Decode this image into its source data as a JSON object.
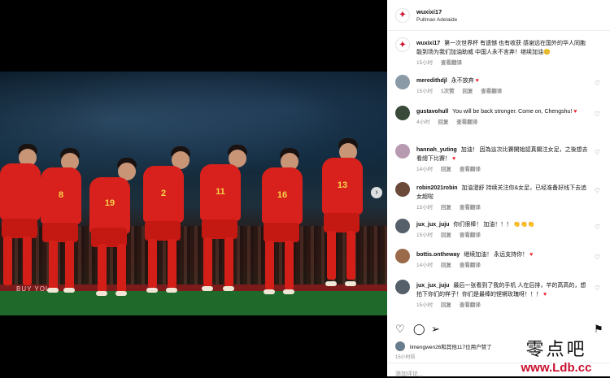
{
  "post": {
    "username": "wuxixi17",
    "location": "Pullman Adelaide",
    "caption": "第一次世界杯 有遗憾 也有收获 感谢远在国外的华人同胞能到场为我们加油助威 中国人永不言弃！继续加油😊",
    "caption_time": "15小时",
    "caption_translate": "查看翻译",
    "photo_ad_text": "BUY YOUR"
  },
  "comments": [
    {
      "username": "meredithdjl",
      "text": "永不放弃",
      "time": "15小时",
      "likes": "1次赞",
      "reply": "回复",
      "translate": "查看翻译",
      "heart": true
    },
    {
      "username": "gustavohull",
      "text": "You will be back stronger. Come on, Chengshu!",
      "time": "4小时",
      "reply": "回复",
      "translate": "查看翻译",
      "heart": true
    },
    {
      "username": "hannah_yuting",
      "text": "加油！ 因為這次比賽開始認真關注女足，之後想去看總下比賽！",
      "time": "14小时",
      "reply": "回复",
      "translate": "查看翻译"
    },
    {
      "username": "robin2021robin",
      "text": "加油澄舒 持续关注你&女足，已经准备好线下去追女超啦",
      "time": "15小时",
      "reply": "回复",
      "translate": "查看翻译"
    },
    {
      "username": "jux_jux_juju",
      "text": "你们很棒！ 加油！！！",
      "time": "15小时",
      "reply": "回复",
      "translate": "查看翻译"
    },
    {
      "username": "bottis.ontheway",
      "text": "继续加油！ 永远支持你！",
      "time": "14小时",
      "reply": "回复",
      "translate": "查看翻译"
    },
    {
      "username": "jux_jux_juju",
      "text": "最后一张看到了我的手机 人在后排，芊的高高的，想拍下你们的样子！你们是最棒的铿锵玫瑰呀！！！",
      "time": "15小时",
      "reply": "回复",
      "translate": "查看翻译"
    }
  ],
  "likes_text": "limengwen26和其他117位用户赞了",
  "time_ago": "15小时前",
  "add_comment_placeholder": "添加评论...",
  "watermark": {
    "cn": "零点吧",
    "url": "www.Ldb.cc"
  },
  "jersey_numbers": [
    "8",
    "19",
    "2",
    "11",
    "16",
    "13"
  ],
  "colors": {
    "jersey": "#d8211c",
    "number": "#f6d24a",
    "heart": "#ed1c24",
    "brand": "#c8102e"
  }
}
